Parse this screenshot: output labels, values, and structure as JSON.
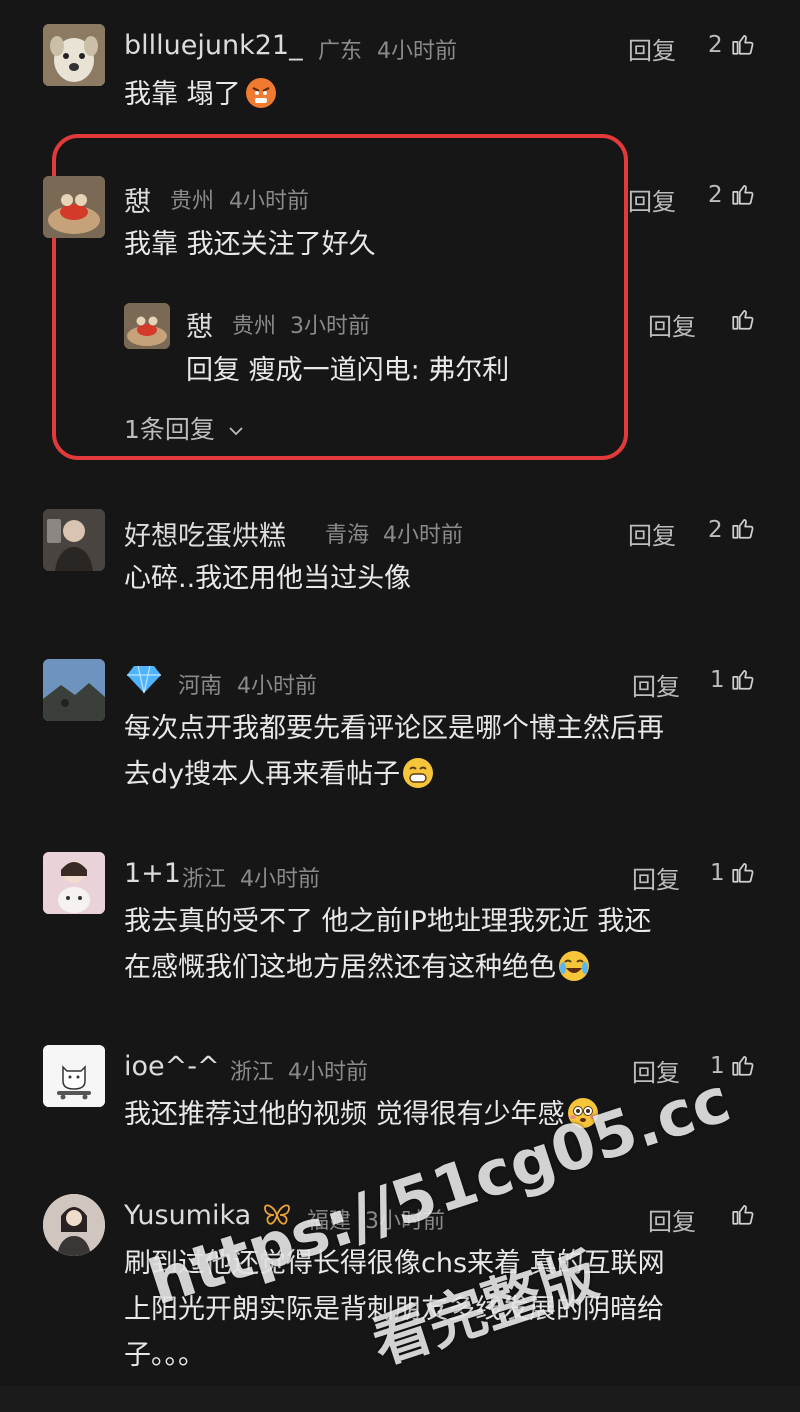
{
  "comments": [
    {
      "user": "bllluejunk21_",
      "region": "广东",
      "time": "4小时前",
      "reply_label": "回复",
      "likes": "2",
      "text": "我靠 塌了"
    },
    {
      "user": "憇",
      "region": "贵州",
      "time": "4小时前",
      "reply_label": "回复",
      "likes": "2",
      "text": "我靠  我还关注了好久",
      "sub_reply": {
        "user": "憇",
        "region": "贵州",
        "time": "3小时前",
        "reply_label": "回复",
        "text": "回复 瘦成一道闪电: 弗尔利"
      },
      "more_replies": "1条回复"
    },
    {
      "user": "好想吃蛋烘糕",
      "region": "青海",
      "time": "4小时前",
      "reply_label": "回复",
      "likes": "2",
      "text": "心碎..我还用他当过头像"
    },
    {
      "user_icon": "diamond-icon",
      "region": "河南",
      "time": "4小时前",
      "reply_label": "回复",
      "likes": "1",
      "text_line1": "每次点开我都要先看评论区是哪个博主然后再",
      "text_line2": "去dy搜本人再来看帖子"
    },
    {
      "user": "1+1",
      "region": "浙江",
      "time": "4小时前",
      "reply_label": "回复",
      "likes": "1",
      "text_line1": "我去真的受不了 他之前IP地址理我死近 我还",
      "text_line2": "在感慨我们这地方居然还有这种绝色"
    },
    {
      "user": "ioe^-^",
      "region": "浙江",
      "time": "4小时前",
      "reply_label": "回复",
      "likes": "1",
      "text": "我还推荐过他的视频  觉得很有少年感"
    },
    {
      "user": "Yusumika",
      "region": "福建",
      "time": "3小时前",
      "reply_label": "回复",
      "text_line1": "刷到过他还觉得长得很像chs来着 真的互联网",
      "text_line2": "上阳光开朗实际是背刺朋友多线发展的阴暗给",
      "text_line3": "子。。。"
    }
  ],
  "watermark": {
    "url": "https://51cg05.cc",
    "text": "看完整版"
  },
  "colors": {
    "background": "#161616",
    "highlight_border": "#e23a3a",
    "meta_text": "#8a8a8a",
    "diamond": "#4fb3ff",
    "vip_butterfly": "#e8a23a"
  }
}
